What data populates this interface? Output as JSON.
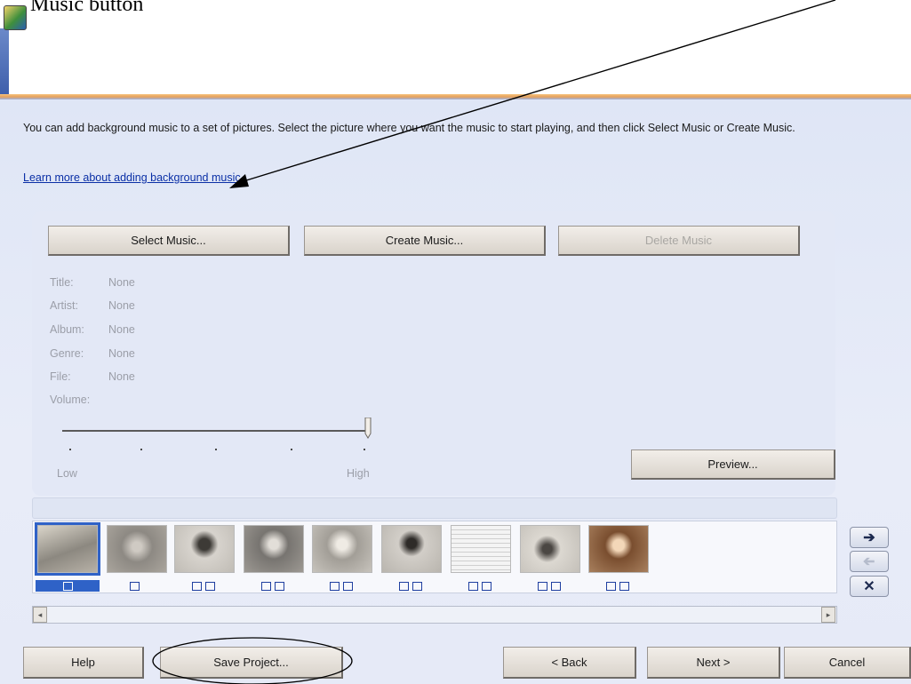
{
  "annotation": {
    "title": "Music button"
  },
  "intro_text": "You can add background music to a set of pictures.  Select the picture where you want the music to start playing, and then click Select Music or Create Music.",
  "learn_more_link": "Learn more about adding background music",
  "music_buttons": {
    "select": "Select Music...",
    "create": "Create Music...",
    "delete": "Delete Music"
  },
  "metadata": {
    "title_label": "Title:",
    "title_value": "None",
    "artist_label": "Artist:",
    "artist_value": "None",
    "album_label": "Album:",
    "album_value": "None",
    "genre_label": "Genre:",
    "genre_value": "None",
    "file_label": "File:",
    "file_value": "None",
    "volume_label": "Volume:"
  },
  "volume": {
    "low_label": "Low",
    "high_label": "High",
    "level": 1.0
  },
  "preview_button": "Preview...",
  "filmstrip": {
    "count": 9,
    "selected_index": 0
  },
  "side_buttons": {
    "next_icon": "arrow-right-icon",
    "prev_icon": "arrow-left-icon",
    "remove_icon": "x-icon"
  },
  "footer": {
    "help": "Help",
    "save_project": "Save Project...",
    "back": "< Back",
    "next": "Next >",
    "cancel": "Cancel"
  },
  "colors": {
    "panel": "#e3e8f6",
    "link": "#0a2fa6",
    "accent": "#2f62c7",
    "header_rule": "#e5a15c"
  }
}
